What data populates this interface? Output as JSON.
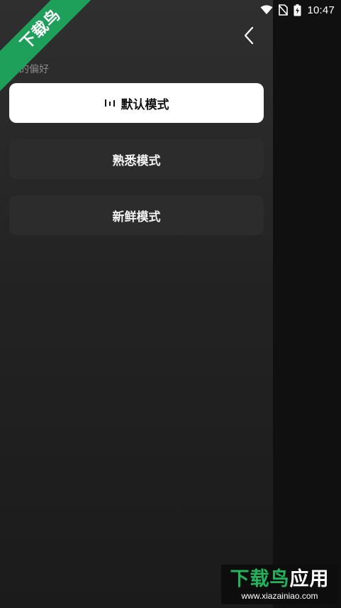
{
  "status_bar": {
    "time": "10:47",
    "wifi_icon": "wifi-icon",
    "sim_icon": "no-sim-icon",
    "battery_icon": "battery-charging-icon"
  },
  "watermark": {
    "ribbon_text": "下载鸟",
    "banner_title_part1": "下载鸟",
    "banner_title_part2": "应用",
    "banner_url": "www.xiazainiao.com",
    "brand_color": "#1fa05a"
  },
  "drawer": {
    "back_icon": "chevron-left-icon",
    "section_label": "我的偏好",
    "modes": [
      {
        "label": "默认模式",
        "active": true
      },
      {
        "label": "熟悉模式",
        "active": false
      },
      {
        "label": "新鲜模式",
        "active": false
      }
    ]
  }
}
